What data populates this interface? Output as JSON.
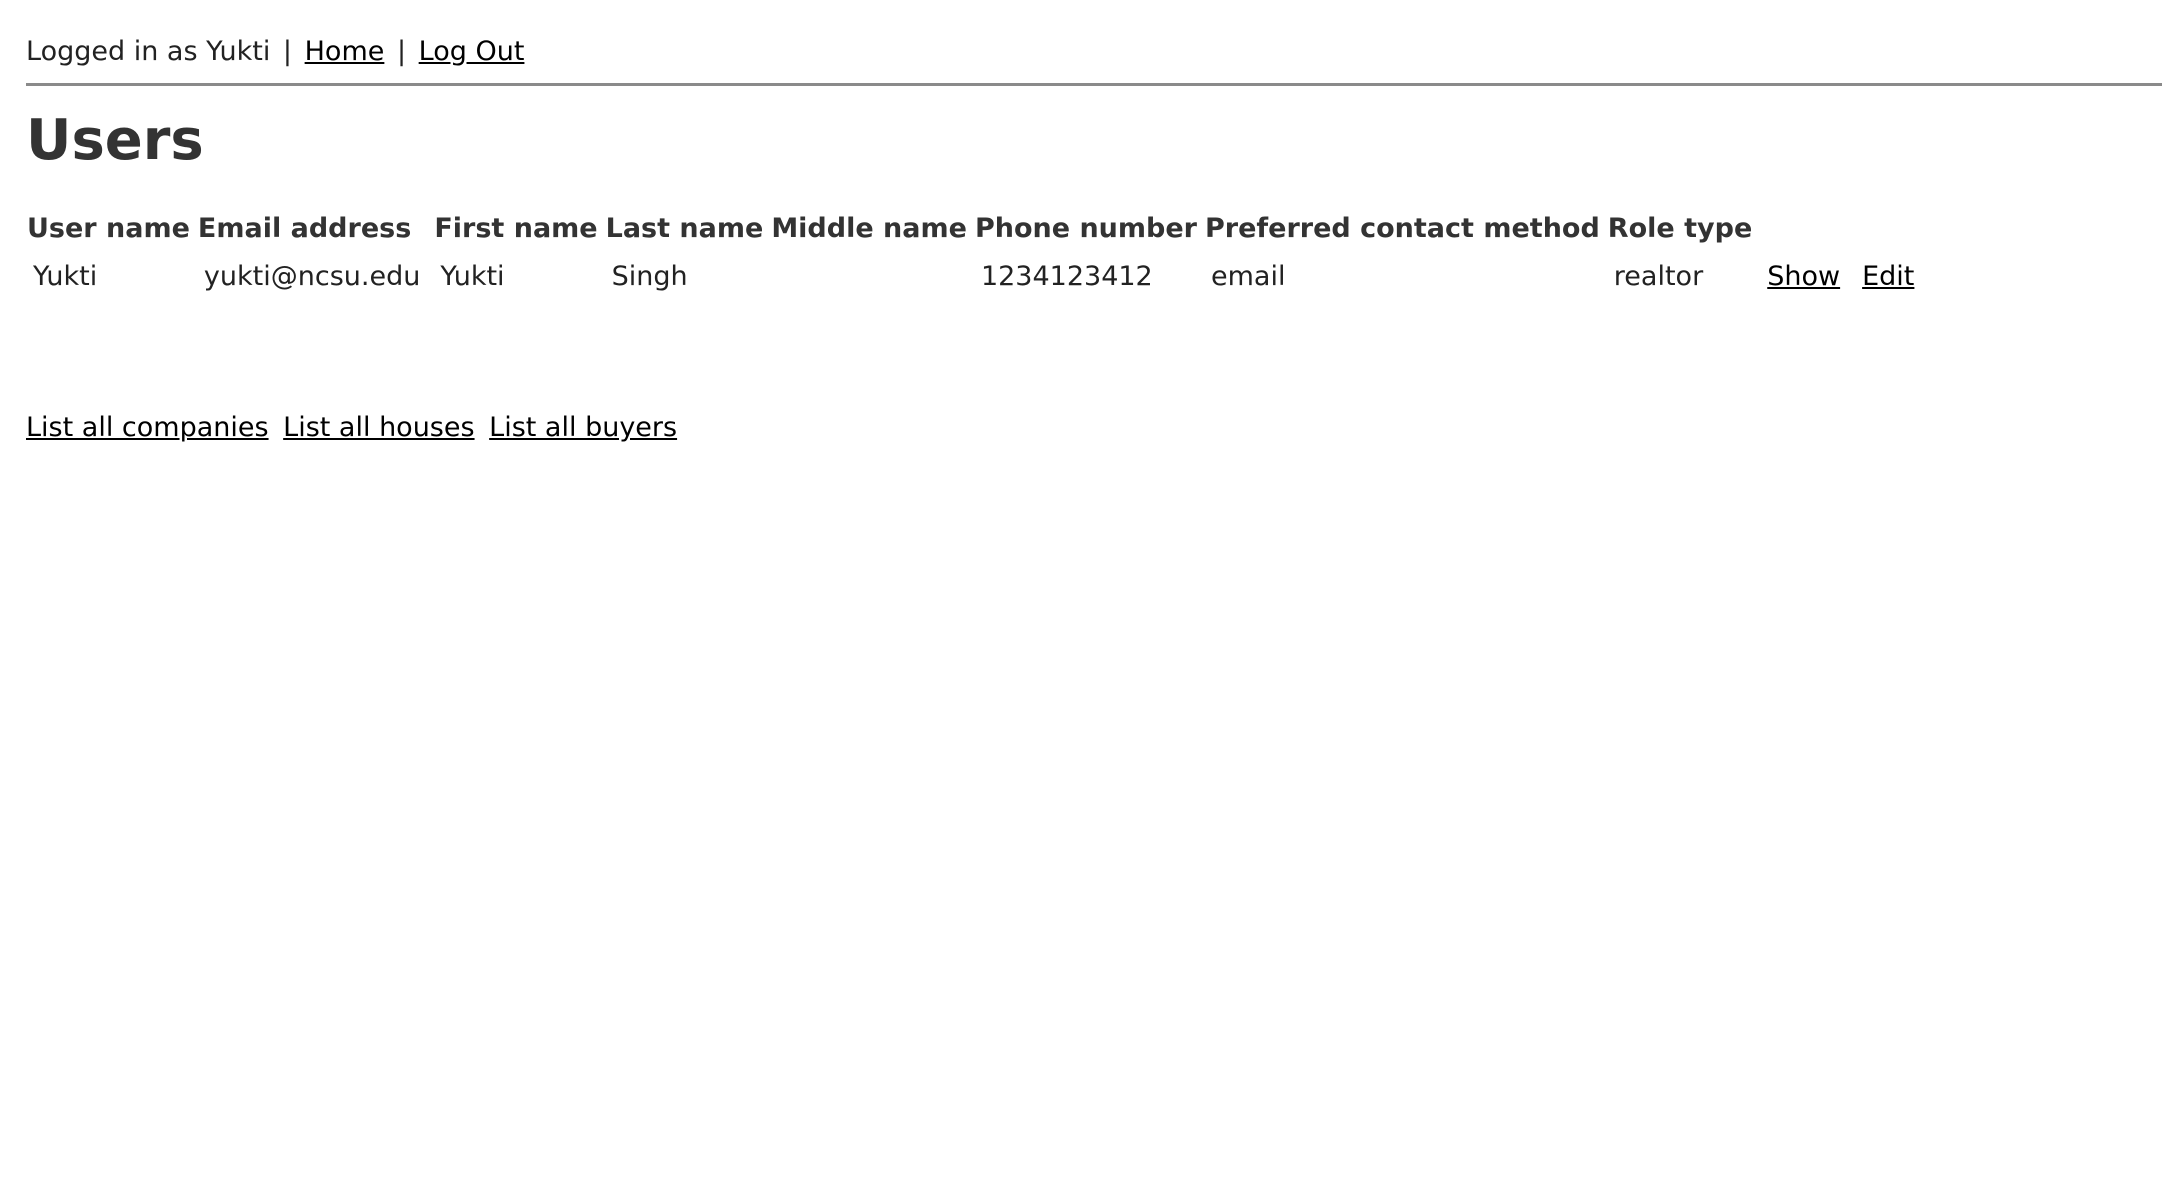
{
  "header": {
    "logged_in_text": "Logged in as Yukti",
    "separator": "|",
    "home_label": "Home",
    "logout_label": "Log Out"
  },
  "page": {
    "title": "Users"
  },
  "table": {
    "columns": [
      "User name",
      "Email address",
      "First name",
      "Last name",
      "Middle name",
      "Phone number",
      "Preferred contact method",
      "Role type"
    ],
    "rows": [
      {
        "user_name": "Yukti",
        "email": "yukti@ncsu.edu",
        "first_name": "Yukti",
        "last_name": "Singh",
        "middle_name": "",
        "phone": "1234123412",
        "contact_method": "email",
        "role_type": "realtor",
        "show_label": "Show",
        "edit_label": "Edit"
      }
    ]
  },
  "footer": {
    "companies_label": "List all companies",
    "houses_label": "List all houses",
    "buyers_label": "List all buyers"
  }
}
